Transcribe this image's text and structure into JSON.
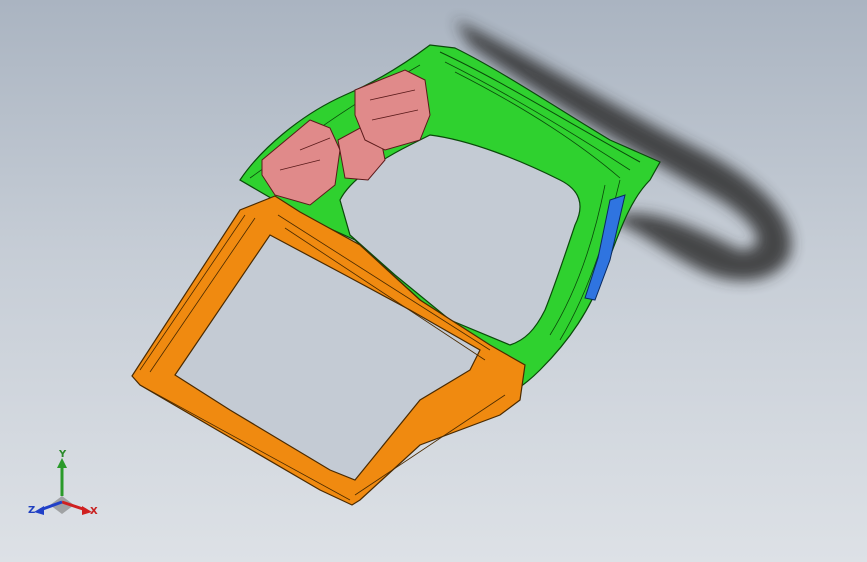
{
  "viewport": {
    "background_top": "#aab4c1",
    "background_bottom": "#dde1e6"
  },
  "model": {
    "colors": {
      "green_frame": "#2fd12f",
      "orange_frame": "#f08a10",
      "pink_brackets": "#e08a8a",
      "blue_bracket": "#2f74e0",
      "shadow": "#2e2e2e"
    }
  },
  "triad": {
    "x_label": "X",
    "y_label": "Y",
    "z_label": "Z",
    "x_color": "#d02020",
    "y_color": "#2a9a2a",
    "z_color": "#2040c8"
  }
}
